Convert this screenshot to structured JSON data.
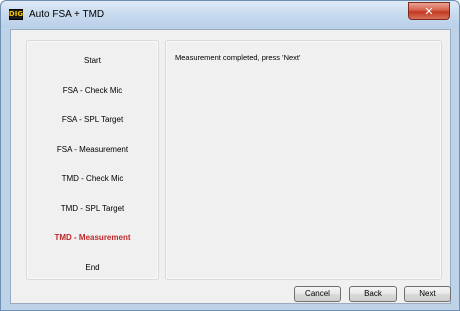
{
  "window": {
    "title": "Auto FSA + TMD",
    "icon_label": "DIG",
    "close_glyph": "✕"
  },
  "steps": [
    {
      "label": "Start",
      "active": false
    },
    {
      "label": "FSA - Check Mic",
      "active": false
    },
    {
      "label": "FSA - SPL Target",
      "active": false
    },
    {
      "label": "FSA - Measurement",
      "active": false
    },
    {
      "label": "TMD - Check Mic",
      "active": false
    },
    {
      "label": "TMD - SPL Target",
      "active": false
    },
    {
      "label": "TMD - Measurement",
      "active": true
    },
    {
      "label": "End",
      "active": false
    }
  ],
  "content": {
    "status": "Measurement completed, press 'Next'"
  },
  "buttons": {
    "cancel": "Cancel",
    "back": "Back",
    "next": "Next"
  },
  "colors": {
    "active_step": "#c0282a",
    "titlebar": "#c6d9ee",
    "panel_bg": "#f0f0f0"
  }
}
